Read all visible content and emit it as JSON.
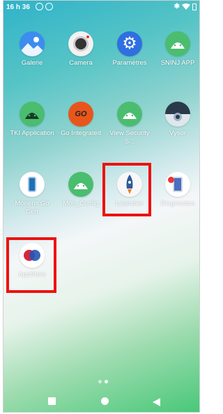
{
  "status_bar": {
    "time": "16 h 36",
    "icons": [
      "shield-check-icon",
      "sync-icon",
      "bluetooth-icon",
      "wifi-icon",
      "battery-icon"
    ]
  },
  "apps": [
    {
      "label": "Galerie",
      "icon": "gallery-icon"
    },
    {
      "label": "Camera",
      "icon": "camera-icon"
    },
    {
      "label": "Paramètres",
      "icon": "gear-icon"
    },
    {
      "label": "SNINJ APP",
      "icon": "android-icon"
    },
    {
      "label": "TKI Application",
      "icon": "android-icon"
    },
    {
      "label": "Go Integrated",
      "icon": "go-integrated-icon"
    },
    {
      "label": "View Security S...",
      "icon": "android-icon"
    },
    {
      "label": "Vysor",
      "icon": "vysor-eye-icon"
    },
    {
      "label": "Moneris Go Cert",
      "icon": "payment-terminal-icon"
    },
    {
      "label": "Mon_Config",
      "icon": "android-icon"
    },
    {
      "label": "Launcher",
      "icon": "rocket-icon"
    },
    {
      "label": "Diagnostics",
      "icon": "diagnostics-icon"
    },
    {
      "label": "AppStore",
      "icon": "appstore-icon"
    }
  ],
  "highlights": [
    "Launcher",
    "AppStore"
  ],
  "highlight_color": "#e11111",
  "page_indicator": {
    "pages": 2,
    "current": 2
  },
  "nav_bar": {
    "icons": [
      "recents-square-icon",
      "home-circle-icon",
      "back-triangle-icon"
    ]
  }
}
